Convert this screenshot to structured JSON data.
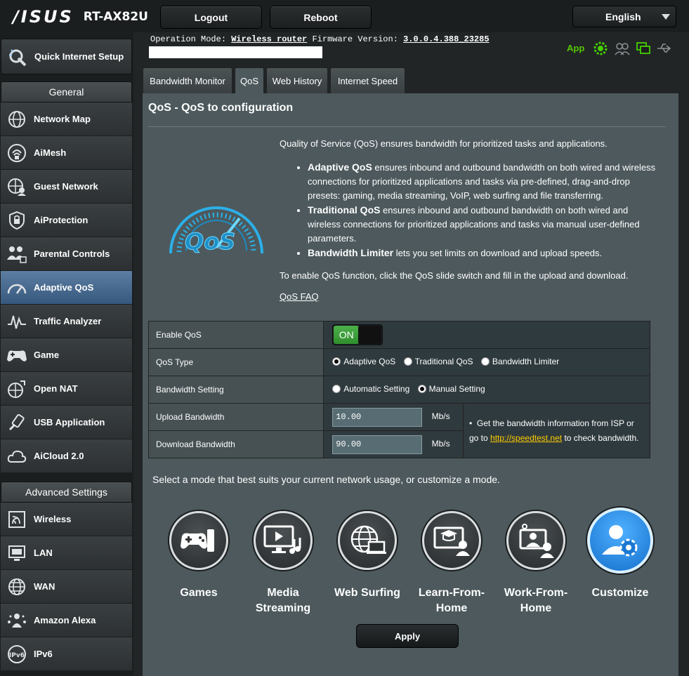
{
  "header": {
    "brand": "/ISUS",
    "model": "RT-AX82U",
    "logout_label": "Logout",
    "reboot_label": "Reboot",
    "language": "English"
  },
  "info": {
    "op_mode_label": "Operation Mode:",
    "op_mode_value": "Wireless router",
    "fw_label": "Firmware Version:",
    "fw_value": "3.0.0.4.388_23285",
    "app_label": "App"
  },
  "sidebar": {
    "qis_label": "Quick Internet Setup",
    "general_header": "General",
    "general_items": [
      {
        "label": "Network Map",
        "icon": "network-map-icon"
      },
      {
        "label": "AiMesh",
        "icon": "aimesh-icon"
      },
      {
        "label": "Guest Network",
        "icon": "guest-network-icon"
      },
      {
        "label": "AiProtection",
        "icon": "lock-icon"
      },
      {
        "label": "Parental Controls",
        "icon": "parental-controls-icon"
      },
      {
        "label": "Adaptive QoS",
        "icon": "speedometer-icon"
      },
      {
        "label": "Traffic Analyzer",
        "icon": "traffic-analyzer-icon"
      },
      {
        "label": "Game",
        "icon": "gamepad-icon"
      },
      {
        "label": "Open NAT",
        "icon": "open-nat-icon"
      },
      {
        "label": "USB Application",
        "icon": "usb-icon"
      },
      {
        "label": "AiCloud 2.0",
        "icon": "cloud-icon"
      }
    ],
    "advanced_header": "Advanced Settings",
    "advanced_items": [
      {
        "label": "Wireless",
        "icon": "wireless-icon"
      },
      {
        "label": "LAN",
        "icon": "lan-icon"
      },
      {
        "label": "WAN",
        "icon": "globe-icon"
      },
      {
        "label": "Amazon Alexa",
        "icon": "alexa-icon"
      },
      {
        "label": "IPv6",
        "icon": "ipv6-icon"
      }
    ]
  },
  "tabs": [
    "Bandwidth Monitor",
    "QoS",
    "Web History",
    "Internet Speed"
  ],
  "panel": {
    "title": "QoS - QoS to configuration",
    "intro": "Quality of Service (QoS) ensures bandwidth for prioritized tasks and applications.",
    "bullets": [
      {
        "bold": "Adaptive QoS",
        "text": " ensures inbound and outbound bandwidth on both wired and wireless connections for prioritized applications and tasks via pre-defined, drag-and-drop presets: gaming, media streaming, VoIP, web surfing and file transferring."
      },
      {
        "bold": "Traditional QoS",
        "text": " ensures inbound and outbound bandwidth on both wired and wireless connections for prioritized applications and tasks via manual user-defined parameters."
      },
      {
        "bold": "Bandwidth Limiter",
        "text": " lets you set limits on download and upload speeds."
      }
    ],
    "enable_note": "To enable QoS function, click the QoS slide switch and fill in the upload and download.",
    "faq_link": "QoS FAQ"
  },
  "settings": {
    "enable_label": "Enable QoS",
    "enable_state": "ON",
    "type_label": "QoS Type",
    "type_options": [
      "Adaptive QoS",
      "Traditional QoS",
      "Bandwidth Limiter"
    ],
    "type_selected": "Adaptive QoS",
    "bw_setting_label": "Bandwidth Setting",
    "bw_options": [
      "Automatic Setting",
      "Manual Setting"
    ],
    "bw_selected": "Manual Setting",
    "upload_label": "Upload Bandwidth",
    "upload_value": "10.00",
    "download_label": "Download Bandwidth",
    "download_value": "90.00",
    "unit": "Mb/s",
    "isp_note_pre": "Get the bandwidth information from ISP or go to ",
    "isp_link": "http://speedtest.net",
    "isp_note_post": " to check bandwidth."
  },
  "modes": {
    "prompt": "Select a mode that best suits your current network usage, or customize a mode.",
    "items": [
      {
        "line1": "Games",
        "line2": "",
        "icon": "games-icon"
      },
      {
        "line1": "Media",
        "line2": "Streaming",
        "icon": "media-streaming-icon"
      },
      {
        "line1": "Web Surfing",
        "line2": "",
        "icon": "web-surfing-icon"
      },
      {
        "line1": "Learn-From-",
        "line2": "Home",
        "icon": "learn-from-home-icon"
      },
      {
        "line1": "Work-From-",
        "line2": "Home",
        "icon": "work-from-home-icon"
      },
      {
        "line1": "Customize",
        "line2": "",
        "icon": "customize-icon"
      }
    ],
    "selected": "Customize"
  },
  "apply_label": "Apply"
}
